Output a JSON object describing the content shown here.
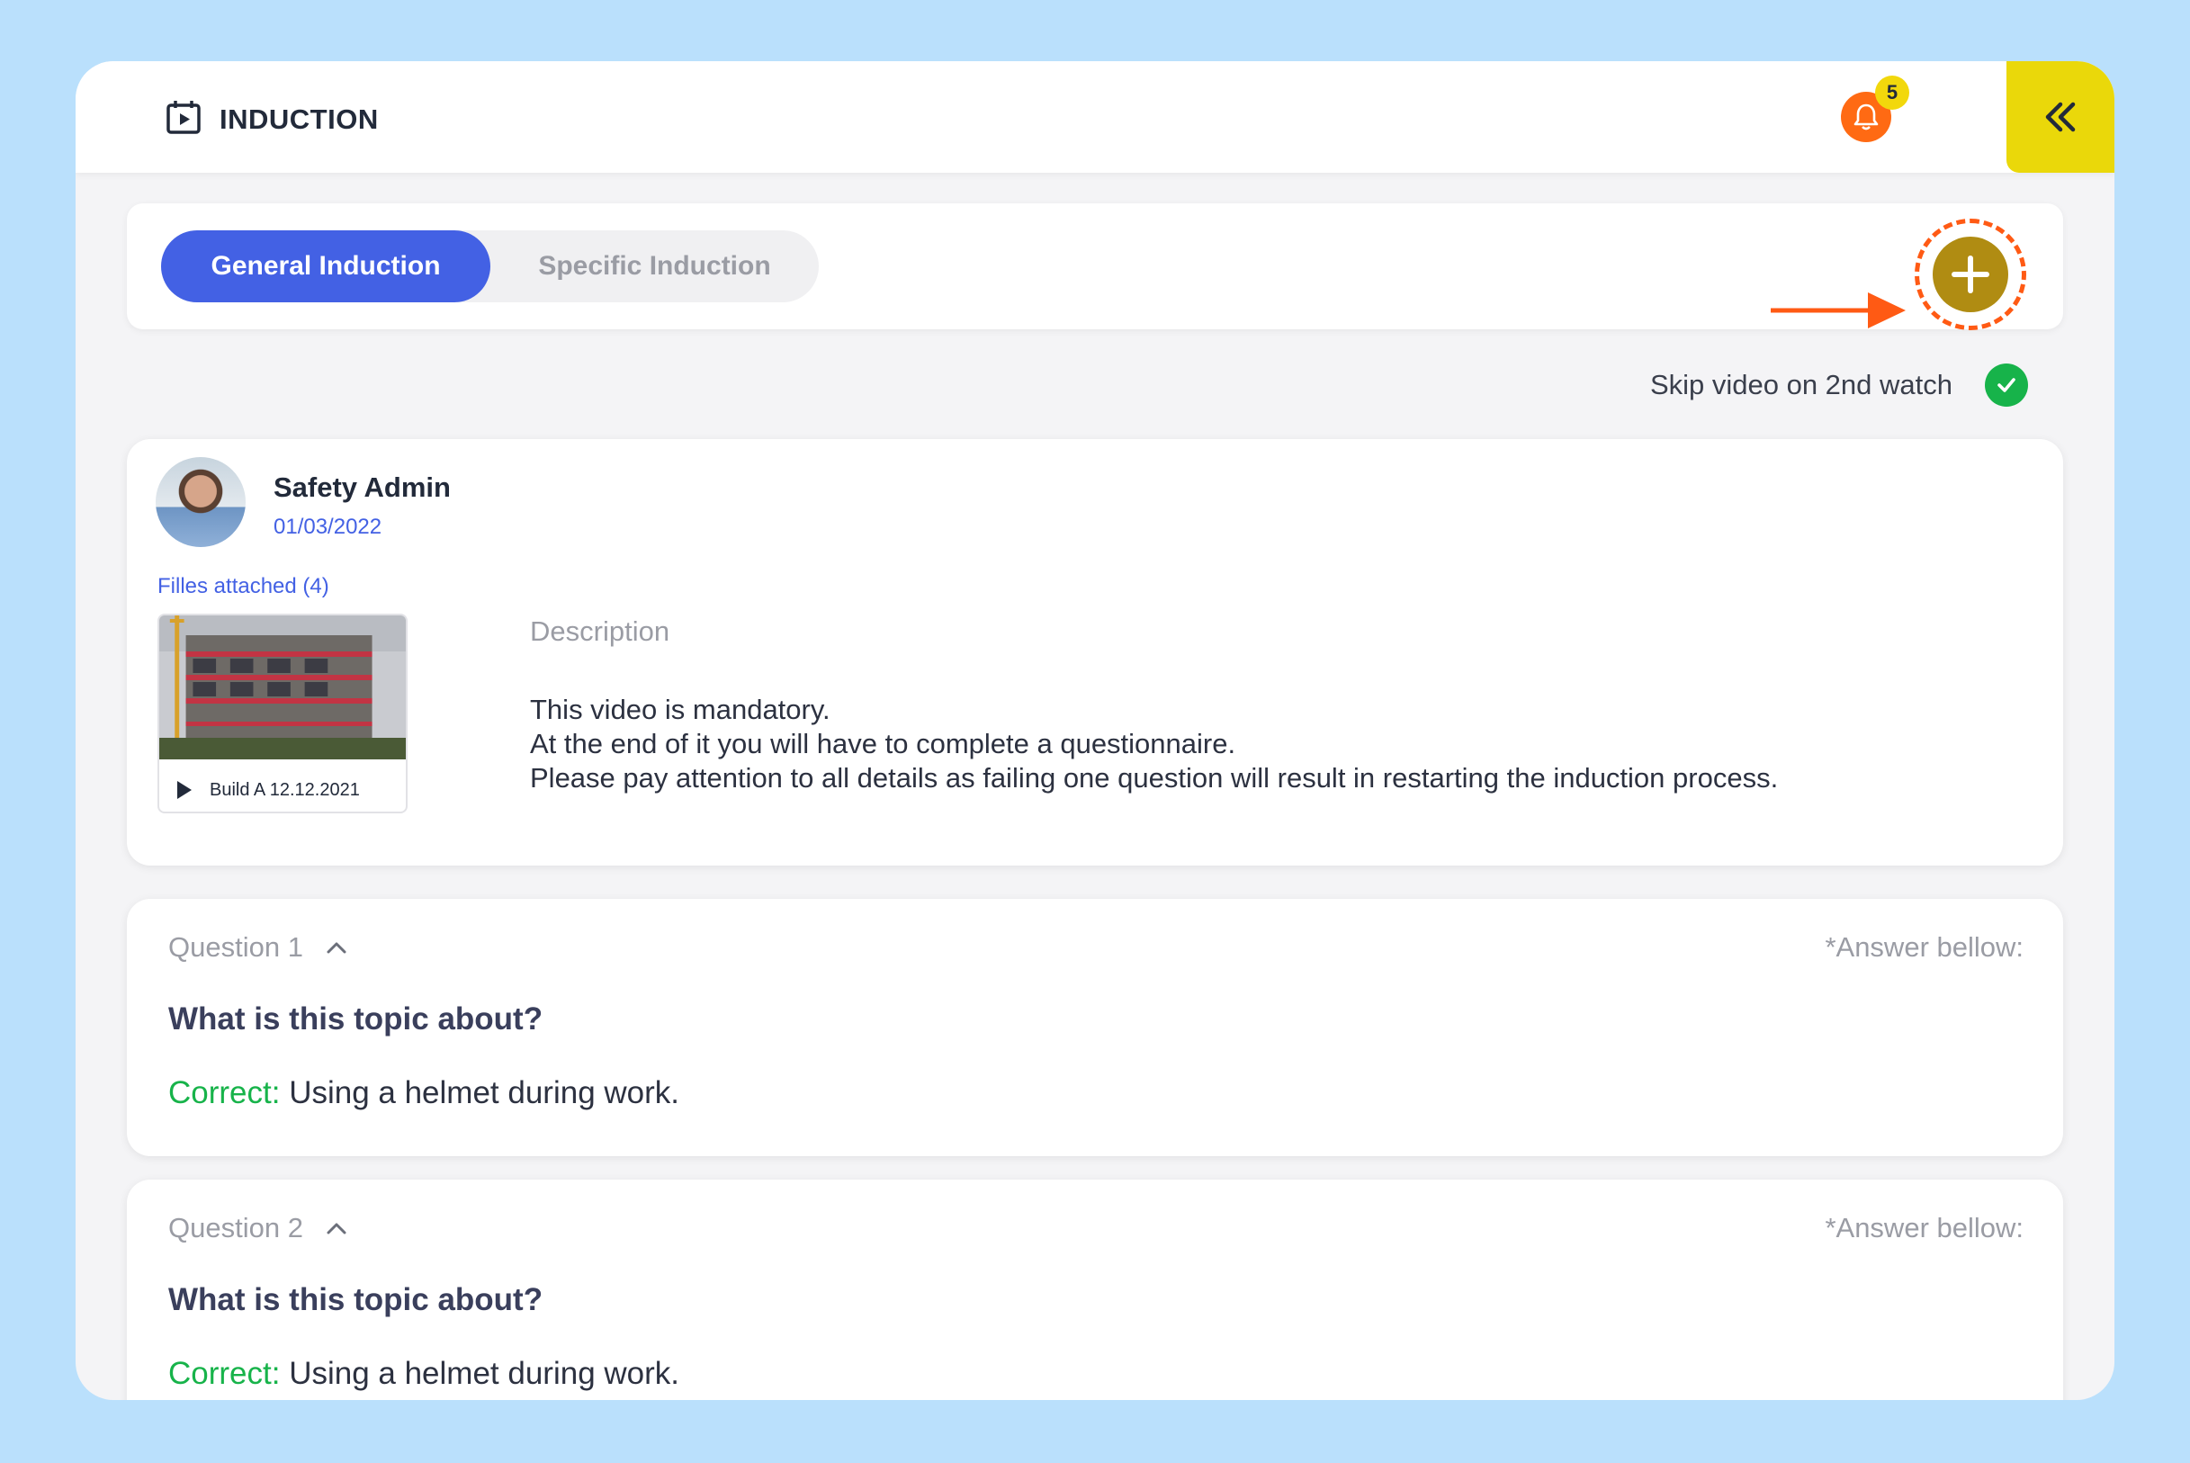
{
  "header": {
    "title": "INDUCTION",
    "notification_count": "5"
  },
  "tabs": [
    {
      "label": "General Induction",
      "active": true
    },
    {
      "label": "Specific Induction",
      "active": false
    }
  ],
  "skip_video": {
    "label": "Skip video on 2nd watch",
    "checked": true
  },
  "post": {
    "author": "Safety Admin",
    "date": "01/03/2022",
    "files_label": "Filles attached (4)",
    "attachment_caption": "Build A 12.12.2021",
    "description_label": "Description",
    "description_lines": [
      "This video is mandatory.",
      "At the end of it you will have to complete a questionnaire.",
      "Please pay attention to all details as failing one question will result in restarting the induction process."
    ]
  },
  "questions": [
    {
      "title": "Question 1",
      "hint": "*Answer bellow:",
      "question": "What is this topic about?",
      "correct_label": "Correct:",
      "answer": " Using a helmet during work."
    },
    {
      "title": "Question 2",
      "hint": "*Answer bellow:",
      "question": "What is this topic about?",
      "correct_label": "Correct:",
      "answer": " Using a helmet during work."
    }
  ],
  "colors": {
    "accent": "#4361e4",
    "notification": "#ff6a13",
    "badge": "#f2d80c",
    "add_button": "#b08c12",
    "callout": "#ff5a14",
    "success": "#17b34a"
  }
}
